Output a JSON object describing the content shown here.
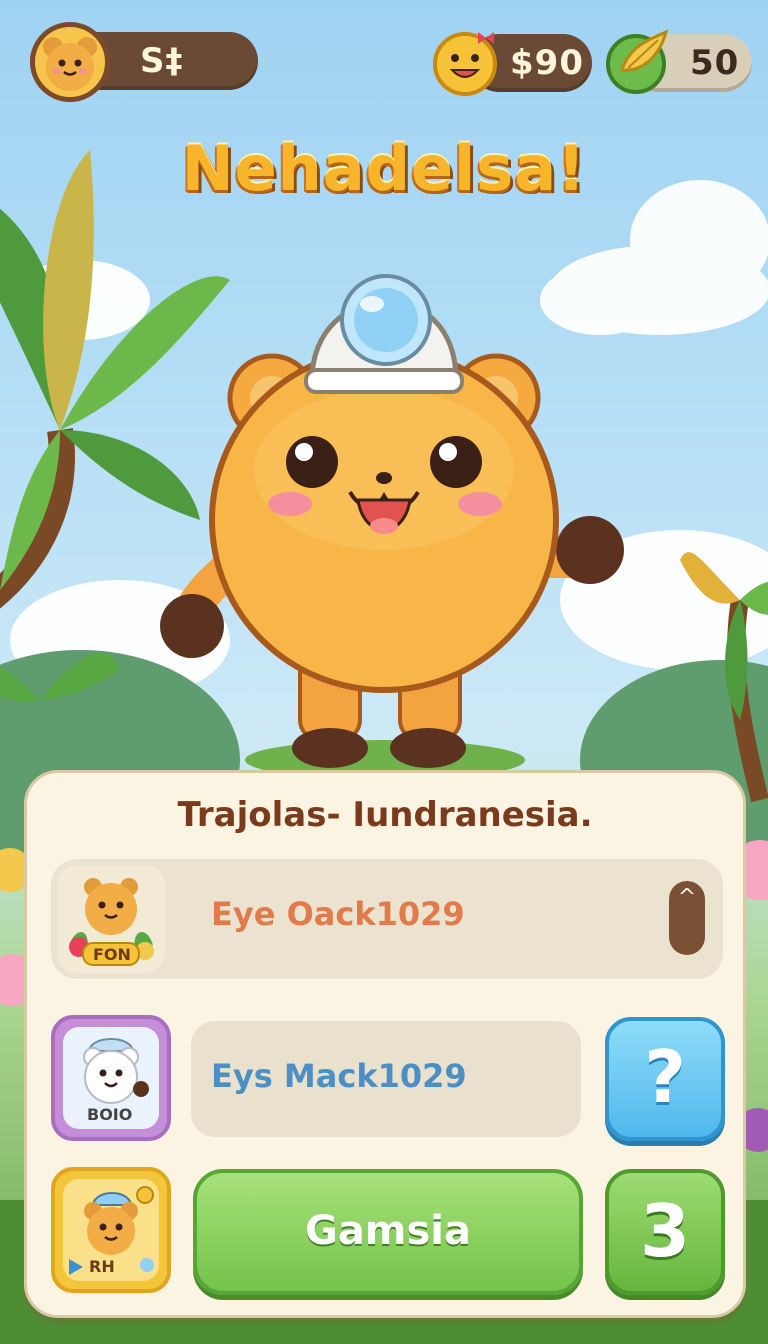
{
  "hud": {
    "player_name": "S‡",
    "coins": "$90",
    "gems": "50"
  },
  "title": "Nehadelsa!",
  "panel": {
    "heading": "Trajolas- Iundranesia.",
    "rows": [
      {
        "label": "Eye Oack1029",
        "badge": "FON",
        "scroll_icon": "^"
      },
      {
        "label": "Eys Mack1029",
        "badge": "BOIO",
        "action": "?"
      },
      {
        "label": "Gamsia",
        "badge": "RH",
        "count": "3"
      }
    ]
  },
  "icons": {
    "player_avatar": "bear-face-icon",
    "coin": "smiley-coin-icon",
    "gem": "leaf-gem-icon",
    "help": "question-icon"
  },
  "colors": {
    "title": "#f6b52a",
    "card": "#fbf4e3",
    "help_button": "#4fb8ec",
    "play_button": "#74c34a",
    "hud_pill": "#6b4a35"
  }
}
